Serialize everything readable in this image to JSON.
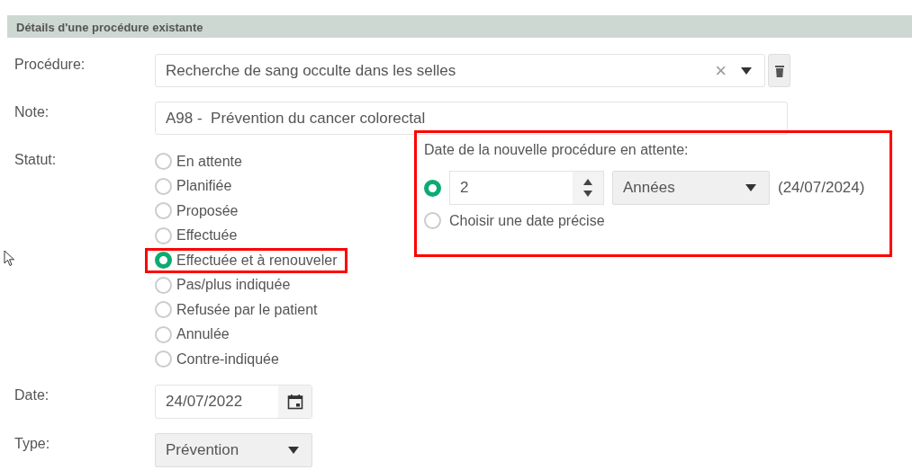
{
  "section": {
    "title": "Détails d'une procédure existante"
  },
  "procedure": {
    "label": "Procédure:",
    "value": "Recherche de sang occulte dans les selles",
    "clear": "×"
  },
  "note": {
    "label": "Note:",
    "value": "A98 -  Prévention du cancer colorectal"
  },
  "status": {
    "label": "Statut:",
    "options": [
      {
        "label": "En attente",
        "selected": false,
        "highlighted": false
      },
      {
        "label": "Planifiée",
        "selected": false,
        "highlighted": false
      },
      {
        "label": "Proposée",
        "selected": false,
        "highlighted": false
      },
      {
        "label": "Effectuée",
        "selected": false,
        "highlighted": false
      },
      {
        "label": "Effectuée et à renouveler",
        "selected": true,
        "highlighted": true
      },
      {
        "label": "Pas/plus indiquée",
        "selected": false,
        "highlighted": false
      },
      {
        "label": "Refusée par le patient",
        "selected": false,
        "highlighted": false
      },
      {
        "label": "Annulée",
        "selected": false,
        "highlighted": false
      },
      {
        "label": "Contre-indiquée",
        "selected": false,
        "highlighted": false
      }
    ]
  },
  "renewal": {
    "highlighted": true,
    "title": "Date de la nouvelle procédure en attente:",
    "options": [
      {
        "kind": "interval",
        "selected": true,
        "amount": "2",
        "unit": "Années",
        "computed": "(24/07/2024)"
      },
      {
        "kind": "date",
        "selected": false,
        "label": "Choisir une date précise"
      }
    ]
  },
  "date": {
    "label": "Date:",
    "value": "24/07/2022"
  },
  "type": {
    "label": "Type:",
    "value": "Prévention"
  }
}
